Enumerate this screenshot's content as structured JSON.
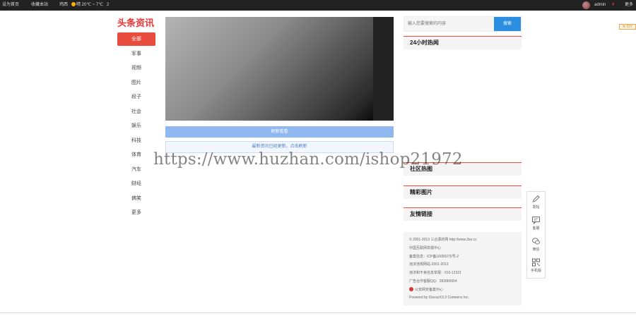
{
  "topbar": {
    "set_home": "设为首页",
    "bookmark": "收藏本站",
    "city": "鸡西",
    "weather": "晴 20℃ ~ 7℃",
    "extra": "2",
    "user": "admin",
    "user_badge": "¥",
    "more": "更多"
  },
  "diy_label": "DIY",
  "logo": "头条资讯",
  "nav": {
    "items": [
      "全部",
      "军事",
      "视频",
      "图片",
      "段子",
      "社会",
      "娱乐",
      "科技",
      "体育",
      "汽车",
      "财经",
      "搞笑",
      "更多"
    ]
  },
  "main": {
    "refresh_label": "刷新看看",
    "update_tip": "最新资讯已经更新，点击刷新"
  },
  "search": {
    "placeholder": "输入您要搜索的内容",
    "button": "搜索"
  },
  "panels": {
    "hot24": "24小时热闻",
    "community": "社区热图",
    "pictures": "精彩图片",
    "links": "友情链接"
  },
  "footer": {
    "lines": [
      "© 2001-2013 三合源的网 http://www.3se.cc",
      "中国互联网举报中心",
      "备案信息：ICP备16050276号-2",
      "违法违规网站-2001-2013",
      "违法和不良信息举报：010-12321",
      "广告合作客服QQ：282865654",
      "公安网安备案中心",
      "Powered by DiscuzX3.3  Comsenz Inc."
    ]
  },
  "side_tools": [
    "发帖",
    "客服",
    "微信",
    "手机版"
  ],
  "watermark": "https://www.huzhan.com/ishop21972",
  "colors": {
    "accent_red": "#e74c3c",
    "search_blue": "#2b8ee0",
    "refresh_blue": "#8fb8f0",
    "topbar_bg": "#222222"
  }
}
